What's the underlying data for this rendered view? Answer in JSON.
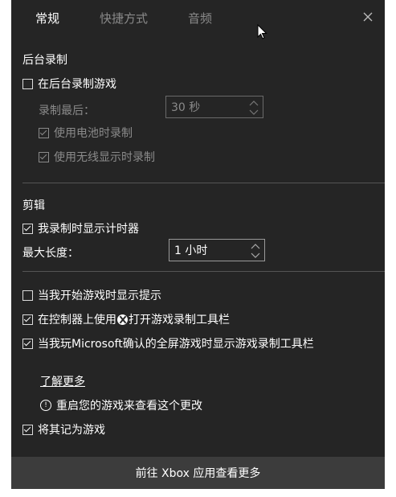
{
  "tabs": [
    {
      "label": "常规",
      "active": true
    },
    {
      "label": "快捷方式",
      "active": false
    },
    {
      "label": "音频",
      "active": false
    }
  ],
  "background_recording": {
    "heading": "后台录制",
    "record_in_background": {
      "label": "在后台录制游戏",
      "checked": false
    },
    "record_last_label": "录制最后：",
    "record_last_value": "30 秒",
    "record_on_battery": {
      "label": "使用电池时录制",
      "checked": true,
      "enabled": false
    },
    "record_wireless_display": {
      "label": "使用无线显示时录制",
      "checked": true,
      "enabled": false
    }
  },
  "clips": {
    "heading": "剪辑",
    "show_timer": {
      "label": "我录制时显示计时器",
      "checked": true
    },
    "max_length_label": "最大长度：",
    "max_length_value": "1 小时"
  },
  "options": {
    "show_tips": {
      "label": "当我开始游戏时显示提示",
      "checked": false
    },
    "controller_open_bar": {
      "label_pre": "在控制器上使用",
      "label_post": "打开游戏录制工具栏",
      "checked": true
    },
    "fullscreen_bar": {
      "label": "当我玩Microsoft确认的全屏游戏时显示游戏录制工具栏",
      "checked": true
    }
  },
  "learn_more": "了解更多",
  "restart_notice": "重启您的游戏来查看这个更改",
  "remember_as_game": {
    "label": "将其记为游戏",
    "checked": true
  },
  "footer_button": "前往 Xbox 应用查看更多",
  "icons": {
    "close": "close-icon",
    "checkbox": "checkbox",
    "info": "info-icon",
    "xbox": "xbox-logo-icon",
    "spinner": "spinner-arrows-icon",
    "cursor": "mouse-cursor-icon"
  },
  "colors": {
    "panel_bg": "#252525",
    "footer_bg": "#3c3c3c",
    "text": "#ffffff",
    "disabled_text": "#8a8a8a"
  }
}
